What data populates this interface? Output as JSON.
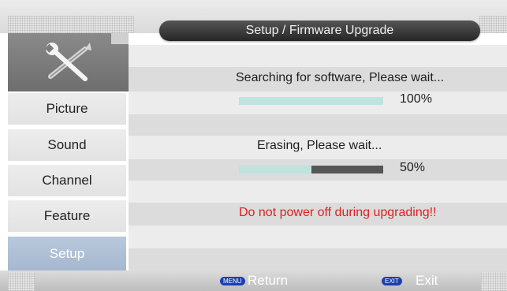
{
  "header": {
    "title": "Setup / Firmware Upgrade"
  },
  "sidebar": {
    "icon": "tools-icon",
    "items": [
      {
        "label": "Picture",
        "active": false
      },
      {
        "label": "Sound",
        "active": false
      },
      {
        "label": "Channel",
        "active": false
      },
      {
        "label": "Feature",
        "active": false
      },
      {
        "label": "Setup",
        "active": true
      }
    ]
  },
  "upgrade": {
    "search_text": "Searching for software, Please wait...",
    "search_progress": 100,
    "search_percent": "100%",
    "erase_text": "Erasing, Please wait...",
    "erase_progress": 50,
    "erase_percent": "50%",
    "warning": "Do not power off during upgrading!!"
  },
  "footer": {
    "menu_key": "MENU",
    "menu_label": "Return",
    "exit_key": "EXIT",
    "exit_label": "Exit"
  },
  "colors": {
    "title_bg": "#262626",
    "active_item": "#a6b8cf",
    "progress_fill": "#bfe3df",
    "progress_track": "#565656",
    "warning_text": "#e02020",
    "key_chip": "#1d3fb0"
  }
}
